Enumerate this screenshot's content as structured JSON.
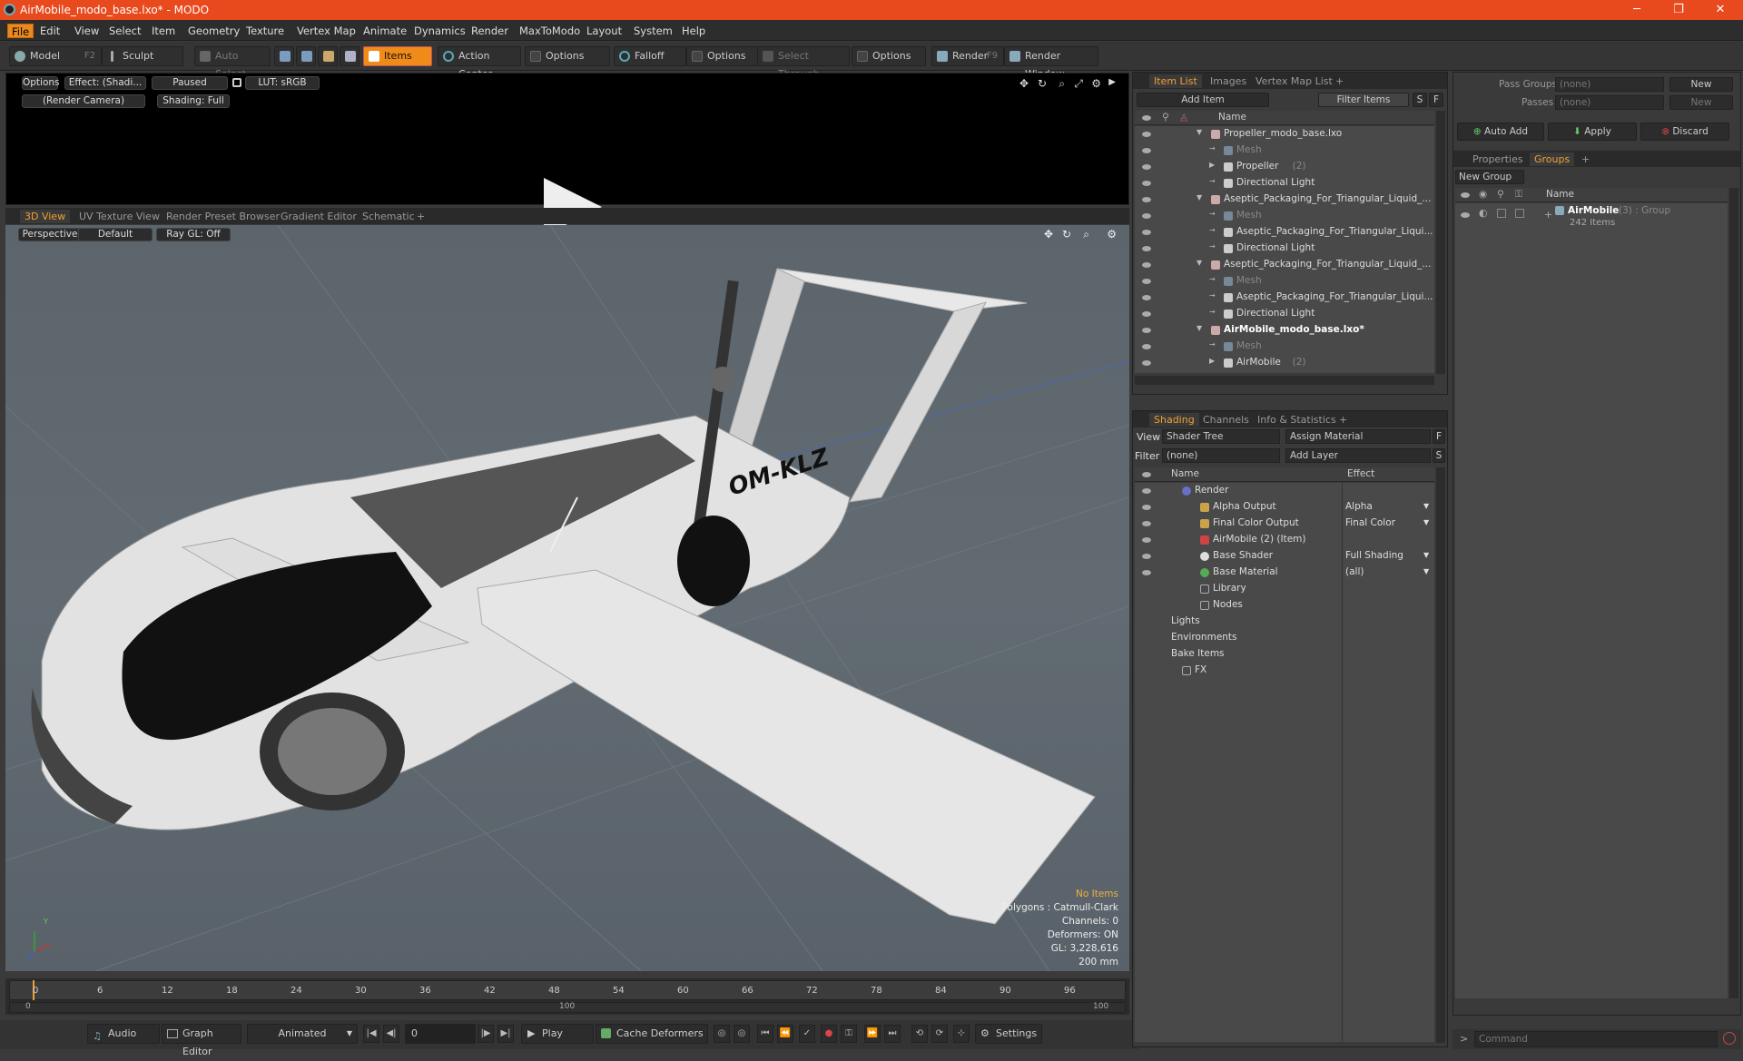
{
  "window": {
    "title": "AirMobile_modo_base.lxo* - MODO",
    "minimize": "─",
    "maximize": "❐",
    "close": "✕"
  },
  "menu": [
    "File",
    "Edit",
    "View",
    "Select",
    "Item",
    "Geometry",
    "Texture",
    "Vertex Map",
    "Animate",
    "Dynamics",
    "Render",
    "MaxToModo",
    "Layout",
    "System",
    "Help"
  ],
  "toolbar": {
    "model": "Model",
    "model_key": "F2",
    "sculpt": "Sculpt",
    "auto_select": "Auto Select",
    "items": "Items",
    "action_center": "Action Center",
    "options1": "Options",
    "falloff": "Falloff",
    "options2": "Options",
    "select_through": "Select Through",
    "options3": "Options",
    "render": "Render",
    "render_key": "F9",
    "render_window": "Render Window"
  },
  "preview": {
    "options": "Options",
    "effect": "Effect: (Shadi...",
    "paused": "Paused",
    "lut": "LUT: sRGB",
    "camera": "(Render Camera)",
    "shading": "Shading: Full"
  },
  "viewport_tabs": [
    "3D View",
    "UV Texture View",
    "Render Preset Browser",
    "Gradient Editor",
    "Schematic",
    "+"
  ],
  "viewport": {
    "perspective": "Perspective",
    "default": "Default",
    "raygl": "Ray GL: Off",
    "tail_number": "OM-KLZ",
    "info": {
      "items": "No Items",
      "polygons": "Polygons : Catmull-Clark",
      "channels": "Channels: 0",
      "deformers": "Deformers: ON",
      "gl": "GL: 3,228,616",
      "scale": "200 mm"
    },
    "axis_y": "Y"
  },
  "timeline": {
    "ticks": [
      "0",
      "6",
      "12",
      "18",
      "24",
      "30",
      "36",
      "42",
      "48",
      "54",
      "60",
      "66",
      "72",
      "78",
      "84",
      "90",
      "96"
    ],
    "sub_ticks": [
      "0",
      "100",
      "100"
    ]
  },
  "bottom": {
    "audio": "Audio",
    "graph_editor": "Graph Editor",
    "animated": "Animated",
    "frame": "0",
    "play": "Play",
    "cache_deformers": "Cache Deformers",
    "settings": "Settings"
  },
  "item_list": {
    "tabs": [
      "Item List",
      "Images",
      "Vertex Map List",
      "+"
    ],
    "add_item": "Add Item",
    "filter_items": "Filter Items",
    "s": "S",
    "f": "F",
    "col_name": "Name",
    "rows": [
      {
        "label": "Propeller_modo_base.lxo",
        "indent": 0,
        "dim": false,
        "bold": false,
        "count": ""
      },
      {
        "label": "Mesh",
        "indent": 1,
        "dim": true,
        "bold": false,
        "count": ""
      },
      {
        "label": "Propeller",
        "indent": 1,
        "dim": false,
        "bold": false,
        "count": "(2)"
      },
      {
        "label": "Directional Light",
        "indent": 1,
        "dim": false,
        "bold": false,
        "count": ""
      },
      {
        "label": "Aseptic_Packaging_For_Triangular_Liquid_...",
        "indent": 0,
        "dim": false,
        "bold": false,
        "count": ""
      },
      {
        "label": "Mesh",
        "indent": 1,
        "dim": true,
        "bold": false,
        "count": ""
      },
      {
        "label": "Aseptic_Packaging_For_Triangular_Liqui...",
        "indent": 1,
        "dim": false,
        "bold": false,
        "count": ""
      },
      {
        "label": "Directional Light",
        "indent": 1,
        "dim": false,
        "bold": false,
        "count": ""
      },
      {
        "label": "Aseptic_Packaging_For_Triangular_Liquid_...",
        "indent": 0,
        "dim": false,
        "bold": false,
        "count": ""
      },
      {
        "label": "Mesh",
        "indent": 1,
        "dim": true,
        "bold": false,
        "count": ""
      },
      {
        "label": "Aseptic_Packaging_For_Triangular_Liqui...",
        "indent": 1,
        "dim": false,
        "bold": false,
        "count": ""
      },
      {
        "label": "Directional Light",
        "indent": 1,
        "dim": false,
        "bold": false,
        "count": ""
      },
      {
        "label": "AirMobile_modo_base.lxo*",
        "indent": 0,
        "dim": false,
        "bold": true,
        "count": ""
      },
      {
        "label": "Mesh",
        "indent": 1,
        "dim": true,
        "bold": false,
        "count": ""
      },
      {
        "label": "AirMobile",
        "indent": 1,
        "dim": false,
        "bold": false,
        "count": "(2)"
      }
    ]
  },
  "shading": {
    "tabs": [
      "Shading",
      "Channels",
      "Info & Statistics",
      "+"
    ],
    "view_label": "View",
    "view_value": "Shader Tree",
    "assign_material": "Assign Material",
    "f": "F",
    "filter_label": "Filter",
    "filter_value": "(none)",
    "add_layer": "Add Layer",
    "s": "S",
    "col_name": "Name",
    "col_effect": "Effect",
    "rows": [
      {
        "label": "Render",
        "effect": "",
        "indent": 0
      },
      {
        "label": "Alpha Output",
        "effect": "Alpha",
        "indent": 1
      },
      {
        "label": "Final Color Output",
        "effect": "Final Color",
        "indent": 1
      },
      {
        "label": "AirMobile (2) (Item)",
        "effect": "",
        "indent": 1
      },
      {
        "label": "Base Shader",
        "effect": "Full Shading",
        "indent": 1
      },
      {
        "label": "Base Material",
        "effect": "(all)",
        "indent": 1
      },
      {
        "label": "Library",
        "effect": "",
        "indent": 1
      },
      {
        "label": "Nodes",
        "effect": "",
        "indent": 1
      },
      {
        "label": "Lights",
        "effect": "",
        "indent": 0
      },
      {
        "label": "Environments",
        "effect": "",
        "indent": 0
      },
      {
        "label": "Bake Items",
        "effect": "",
        "indent": 0
      },
      {
        "label": "FX",
        "effect": "",
        "indent": 0
      }
    ]
  },
  "groups_panel": {
    "pass_groups": "Pass Groups",
    "pass_groups_value": "(none)",
    "new1": "New",
    "passes": "Passes",
    "passes_value": "(none)",
    "new2": "New",
    "auto_add": "Auto Add",
    "apply": "Apply",
    "discard": "Discard",
    "tabs": [
      "Properties",
      "Groups",
      "+"
    ],
    "new_group": "New Group",
    "col_name": "Name",
    "group_name": "AirMobile",
    "group_meta": "(3) : Group",
    "group_items": "242 Items"
  },
  "command": {
    "placeholder": "Command"
  }
}
